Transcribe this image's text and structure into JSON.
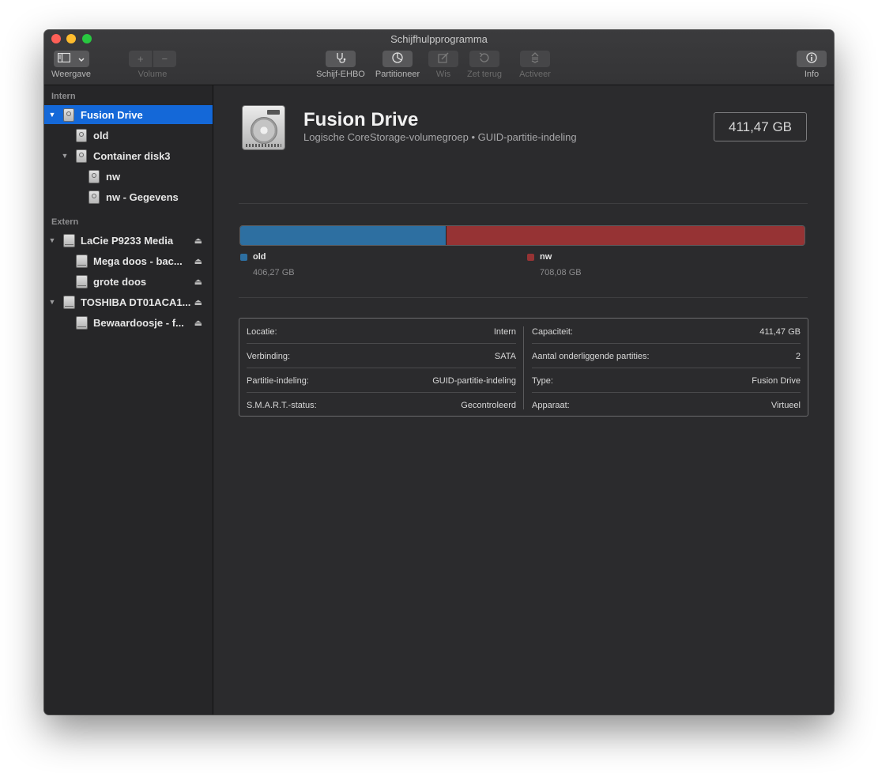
{
  "window": {
    "title": "Schijfhulpprogramma"
  },
  "toolbar": {
    "view_label": "Weergave",
    "volume_label": "Volume",
    "first_aid_label": "Schijf-EHBO",
    "partition_label": "Partitioneer",
    "erase_label": "Wis",
    "restore_label": "Zet terug",
    "mount_label": "Activeer",
    "info_label": "Info"
  },
  "sidebar": {
    "internal_header": "Intern",
    "external_header": "Extern",
    "internal_items": [
      {
        "label": "Fusion Drive",
        "selected": true
      },
      {
        "label": "old"
      },
      {
        "label": "Container disk3"
      },
      {
        "label": "nw"
      },
      {
        "label": "nw - Gegevens"
      }
    ],
    "external_items": [
      {
        "label": "LaCie P9233 Media"
      },
      {
        "label": "Mega doos - bac..."
      },
      {
        "label": "grote doos"
      },
      {
        "label": "TOSHIBA DT01ACA1..."
      },
      {
        "label": "Bewaardoosje - f..."
      }
    ]
  },
  "drive": {
    "name": "Fusion Drive",
    "subtitle": "Logische CoreStorage-volumegroep • GUID-partitie-indeling",
    "size": "411,47 GB"
  },
  "usage": {
    "segments": [
      {
        "name": "old",
        "value": "406,27 GB",
        "fraction": 0.365,
        "color": "#2d6fa1"
      },
      {
        "name": "nw",
        "value": "708,08 GB",
        "fraction": 0.635,
        "color": "#963334"
      }
    ]
  },
  "info": {
    "left": [
      {
        "label": "Locatie:",
        "value": "Intern"
      },
      {
        "label": "Verbinding:",
        "value": "SATA"
      },
      {
        "label": "Partitie-indeling:",
        "value": "GUID-partitie-indeling"
      },
      {
        "label": "S.M.A.R.T.-status:",
        "value": "Gecontroleerd"
      }
    ],
    "right": [
      {
        "label": "Capaciteit:",
        "value": "411,47 GB"
      },
      {
        "label": "Aantal onderliggende partities:",
        "value": "2"
      },
      {
        "label": "Type:",
        "value": "Fusion Drive"
      },
      {
        "label": "Apparaat:",
        "value": "Virtueel"
      }
    ]
  }
}
